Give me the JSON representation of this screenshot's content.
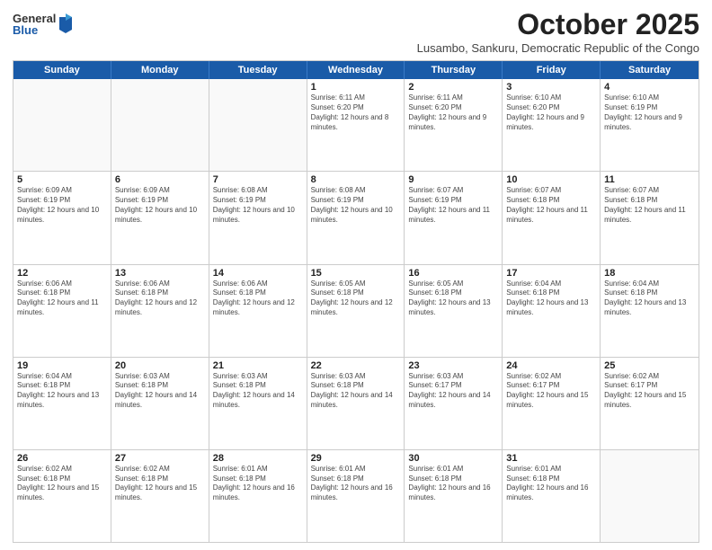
{
  "logo": {
    "general": "General",
    "blue": "Blue"
  },
  "header": {
    "month": "October 2025",
    "subtitle": "Lusambo, Sankuru, Democratic Republic of the Congo"
  },
  "weekdays": [
    "Sunday",
    "Monday",
    "Tuesday",
    "Wednesday",
    "Thursday",
    "Friday",
    "Saturday"
  ],
  "rows": [
    [
      {
        "day": "",
        "info": ""
      },
      {
        "day": "",
        "info": ""
      },
      {
        "day": "",
        "info": ""
      },
      {
        "day": "1",
        "info": "Sunrise: 6:11 AM\nSunset: 6:20 PM\nDaylight: 12 hours and 8 minutes."
      },
      {
        "day": "2",
        "info": "Sunrise: 6:11 AM\nSunset: 6:20 PM\nDaylight: 12 hours and 9 minutes."
      },
      {
        "day": "3",
        "info": "Sunrise: 6:10 AM\nSunset: 6:20 PM\nDaylight: 12 hours and 9 minutes."
      },
      {
        "day": "4",
        "info": "Sunrise: 6:10 AM\nSunset: 6:19 PM\nDaylight: 12 hours and 9 minutes."
      }
    ],
    [
      {
        "day": "5",
        "info": "Sunrise: 6:09 AM\nSunset: 6:19 PM\nDaylight: 12 hours and 10 minutes."
      },
      {
        "day": "6",
        "info": "Sunrise: 6:09 AM\nSunset: 6:19 PM\nDaylight: 12 hours and 10 minutes."
      },
      {
        "day": "7",
        "info": "Sunrise: 6:08 AM\nSunset: 6:19 PM\nDaylight: 12 hours and 10 minutes."
      },
      {
        "day": "8",
        "info": "Sunrise: 6:08 AM\nSunset: 6:19 PM\nDaylight: 12 hours and 10 minutes."
      },
      {
        "day": "9",
        "info": "Sunrise: 6:07 AM\nSunset: 6:19 PM\nDaylight: 12 hours and 11 minutes."
      },
      {
        "day": "10",
        "info": "Sunrise: 6:07 AM\nSunset: 6:18 PM\nDaylight: 12 hours and 11 minutes."
      },
      {
        "day": "11",
        "info": "Sunrise: 6:07 AM\nSunset: 6:18 PM\nDaylight: 12 hours and 11 minutes."
      }
    ],
    [
      {
        "day": "12",
        "info": "Sunrise: 6:06 AM\nSunset: 6:18 PM\nDaylight: 12 hours and 11 minutes."
      },
      {
        "day": "13",
        "info": "Sunrise: 6:06 AM\nSunset: 6:18 PM\nDaylight: 12 hours and 12 minutes."
      },
      {
        "day": "14",
        "info": "Sunrise: 6:06 AM\nSunset: 6:18 PM\nDaylight: 12 hours and 12 minutes."
      },
      {
        "day": "15",
        "info": "Sunrise: 6:05 AM\nSunset: 6:18 PM\nDaylight: 12 hours and 12 minutes."
      },
      {
        "day": "16",
        "info": "Sunrise: 6:05 AM\nSunset: 6:18 PM\nDaylight: 12 hours and 13 minutes."
      },
      {
        "day": "17",
        "info": "Sunrise: 6:04 AM\nSunset: 6:18 PM\nDaylight: 12 hours and 13 minutes."
      },
      {
        "day": "18",
        "info": "Sunrise: 6:04 AM\nSunset: 6:18 PM\nDaylight: 12 hours and 13 minutes."
      }
    ],
    [
      {
        "day": "19",
        "info": "Sunrise: 6:04 AM\nSunset: 6:18 PM\nDaylight: 12 hours and 13 minutes."
      },
      {
        "day": "20",
        "info": "Sunrise: 6:03 AM\nSunset: 6:18 PM\nDaylight: 12 hours and 14 minutes."
      },
      {
        "day": "21",
        "info": "Sunrise: 6:03 AM\nSunset: 6:18 PM\nDaylight: 12 hours and 14 minutes."
      },
      {
        "day": "22",
        "info": "Sunrise: 6:03 AM\nSunset: 6:18 PM\nDaylight: 12 hours and 14 minutes."
      },
      {
        "day": "23",
        "info": "Sunrise: 6:03 AM\nSunset: 6:17 PM\nDaylight: 12 hours and 14 minutes."
      },
      {
        "day": "24",
        "info": "Sunrise: 6:02 AM\nSunset: 6:17 PM\nDaylight: 12 hours and 15 minutes."
      },
      {
        "day": "25",
        "info": "Sunrise: 6:02 AM\nSunset: 6:17 PM\nDaylight: 12 hours and 15 minutes."
      }
    ],
    [
      {
        "day": "26",
        "info": "Sunrise: 6:02 AM\nSunset: 6:18 PM\nDaylight: 12 hours and 15 minutes."
      },
      {
        "day": "27",
        "info": "Sunrise: 6:02 AM\nSunset: 6:18 PM\nDaylight: 12 hours and 15 minutes."
      },
      {
        "day": "28",
        "info": "Sunrise: 6:01 AM\nSunset: 6:18 PM\nDaylight: 12 hours and 16 minutes."
      },
      {
        "day": "29",
        "info": "Sunrise: 6:01 AM\nSunset: 6:18 PM\nDaylight: 12 hours and 16 minutes."
      },
      {
        "day": "30",
        "info": "Sunrise: 6:01 AM\nSunset: 6:18 PM\nDaylight: 12 hours and 16 minutes."
      },
      {
        "day": "31",
        "info": "Sunrise: 6:01 AM\nSunset: 6:18 PM\nDaylight: 12 hours and 16 minutes."
      },
      {
        "day": "",
        "info": ""
      }
    ]
  ]
}
